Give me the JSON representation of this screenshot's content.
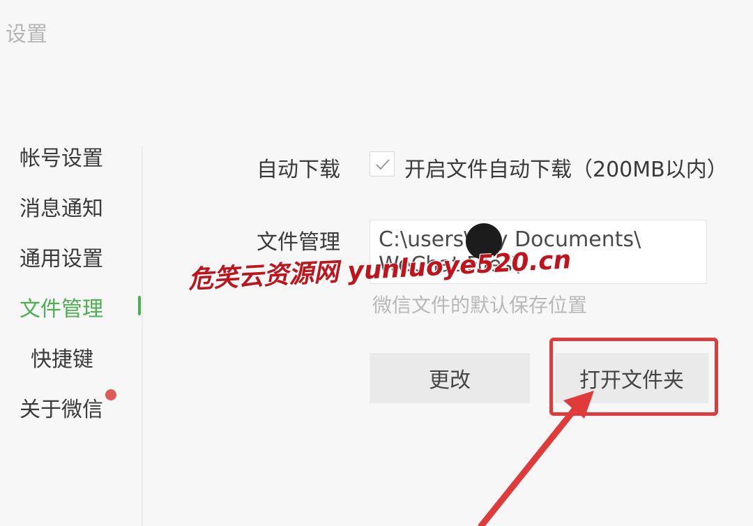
{
  "window": {
    "title": "设置"
  },
  "sidebar": {
    "items": [
      {
        "label": "帐号设置",
        "active": false
      },
      {
        "label": "消息通知",
        "active": false
      },
      {
        "label": "通用设置",
        "active": false
      },
      {
        "label": "文件管理",
        "active": true
      },
      {
        "label": "快捷键",
        "active": false
      },
      {
        "label": "关于微信",
        "active": false,
        "badge": true
      }
    ]
  },
  "content": {
    "auto_download": {
      "label": "自动下载",
      "checkbox_label": "开启文件自动下载（200MB以内）",
      "checked": true
    },
    "file_management": {
      "label": "文件管理",
      "path": "C:\\users\\ My Documents\\\nWeChat Files\\",
      "hint": "微信文件的默认保存位置"
    },
    "buttons": {
      "change": "更改",
      "open_folder": "打开文件夹"
    }
  },
  "overlay": {
    "watermark": "危笑云资源网  yunluoye520.cn"
  },
  "colors": {
    "accent": "#4caf50",
    "annotation": "#e03b3b",
    "badge": "#e05a5a"
  }
}
